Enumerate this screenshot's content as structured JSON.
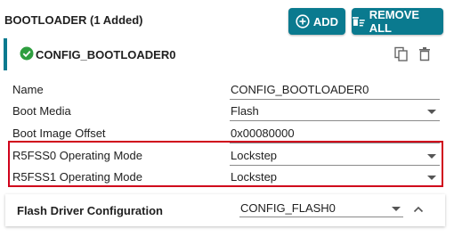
{
  "header": {
    "title": "BOOTLOADER (1 Added)",
    "add_label": "ADD",
    "remove_all_label": "REMOVE ALL"
  },
  "instance": {
    "name": "CONFIG_BOOTLOADER0",
    "status_icon": "check-circle-icon",
    "copy_icon": "copy-icon",
    "delete_icon": "delete-icon"
  },
  "fields": [
    {
      "label": "Name",
      "value": "CONFIG_BOOTLOADER0",
      "type": "text"
    },
    {
      "label": "Boot Media",
      "value": "Flash",
      "type": "select"
    },
    {
      "label": "Boot Image Offset",
      "value": "0x00080000",
      "type": "text"
    },
    {
      "label": "R5FSS0 Operating Mode",
      "value": "Lockstep",
      "type": "select"
    },
    {
      "label": "R5FSS1 Operating Mode",
      "value": "Lockstep",
      "type": "select"
    }
  ],
  "flash_driver": {
    "title": "Flash Driver Configuration",
    "value": "CONFIG_FLASH0"
  },
  "colors": {
    "accent": "#0a7a8f",
    "success": "#2e9e3f",
    "highlight": "#d0021b"
  }
}
